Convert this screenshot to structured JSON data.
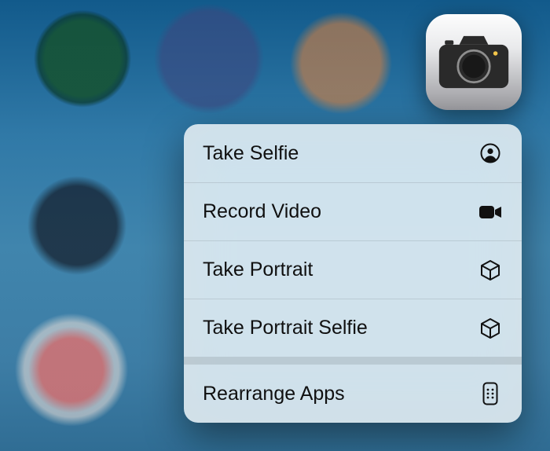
{
  "app_icon": {
    "name": "Camera"
  },
  "menu": {
    "items": [
      {
        "label": "Take Selfie",
        "icon": "selfie-icon"
      },
      {
        "label": "Record Video",
        "icon": "video-icon"
      },
      {
        "label": "Take Portrait",
        "icon": "cube-icon"
      },
      {
        "label": "Take Portrait Selfie",
        "icon": "cube-icon"
      }
    ],
    "footer": {
      "label": "Rearrange Apps",
      "icon": "apps-grid-icon"
    }
  }
}
